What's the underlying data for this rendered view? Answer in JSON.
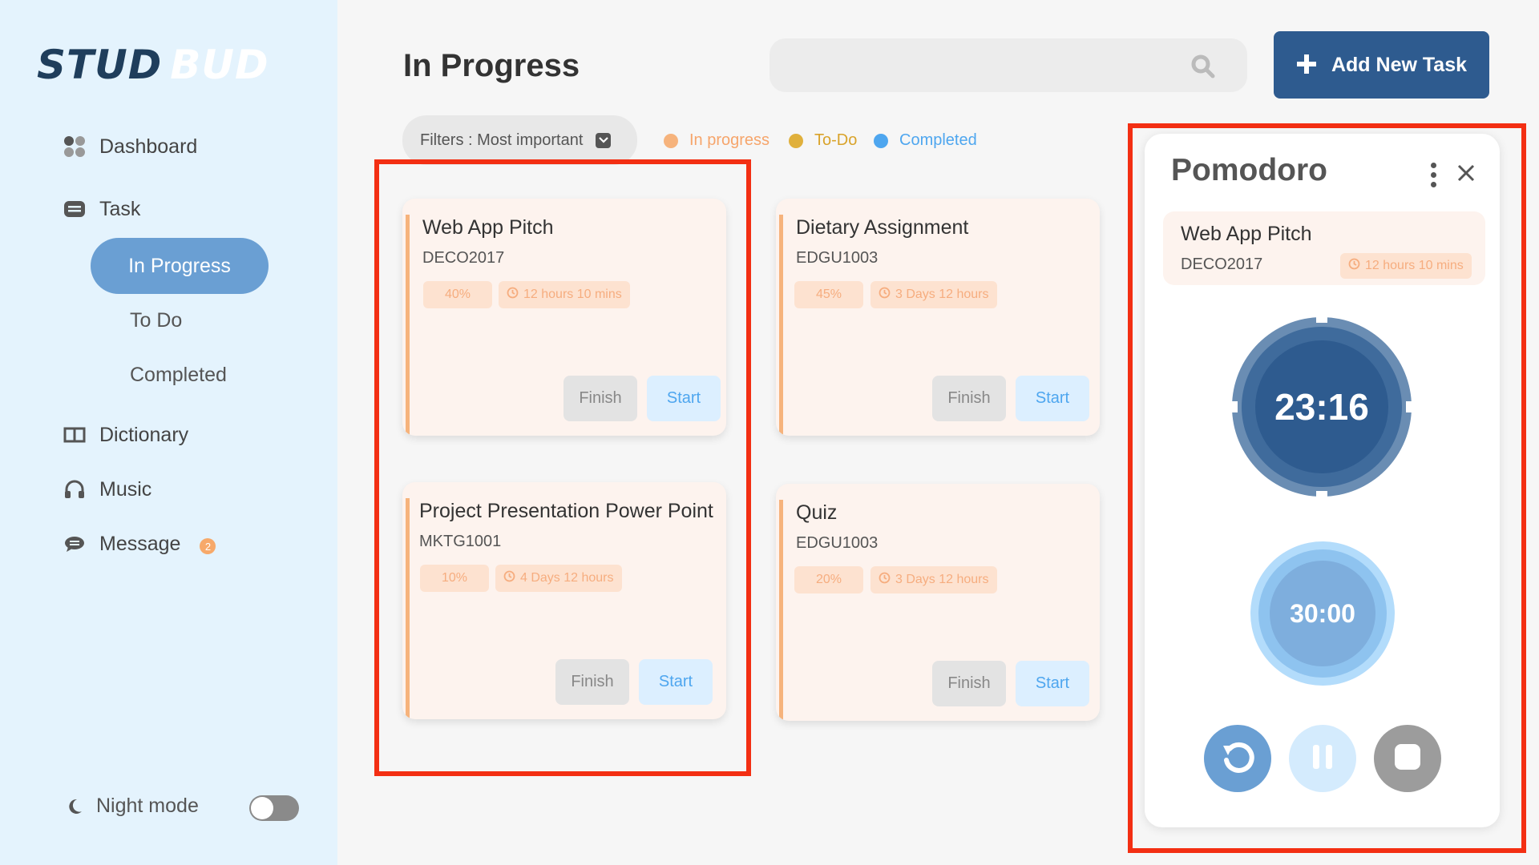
{
  "app": {
    "logo_part1": "STUD",
    "logo_part2": "BUD"
  },
  "sidebar": {
    "dashboard": "Dashboard",
    "task": "Task",
    "in_progress": "In Progress",
    "to_do": "To Do",
    "completed": "Completed",
    "dictionary": "Dictionary",
    "music": "Music",
    "message": "Message",
    "message_badge": "2",
    "night_mode": "Night mode"
  },
  "header": {
    "title": "In Progress",
    "search_placeholder": "",
    "add_button": "Add New Task"
  },
  "filters": {
    "label": "Filters : Most important"
  },
  "legend": [
    {
      "label": "In progress",
      "color": "#f6b37c"
    },
    {
      "label": "To-Do",
      "color": "#e0b03c"
    },
    {
      "label": "Completed",
      "color": "#4ea6ef"
    }
  ],
  "tasks": [
    {
      "title": "Web App Pitch",
      "code": "DECO2017",
      "progress": "40%",
      "time": "12 hours 10 mins",
      "finish": "Finish",
      "start": "Start"
    },
    {
      "title": "Dietary Assignment",
      "code": "EDGU1003",
      "progress": "45%",
      "time": "3 Days 12 hours",
      "finish": "Finish",
      "start": "Start"
    },
    {
      "title": "Project Presentation Power Point",
      "code": "MKTG1001",
      "progress": "10%",
      "time": "4 Days 12 hours",
      "finish": "Finish",
      "start": "Start"
    },
    {
      "title": "Quiz",
      "code": "EDGU1003",
      "progress": "20%",
      "time": "3 Days 12 hours",
      "finish": "Finish",
      "start": "Start"
    }
  ],
  "pomodoro": {
    "title": "Pomodoro",
    "task_title": "Web App Pitch",
    "task_code": "DECO2017",
    "task_time": "12 hours 10 mins",
    "timer_main": "23:16",
    "timer_secondary": "30:00"
  },
  "colors": {
    "primary": "#2e5b8f",
    "active_nav": "#6a9fd3",
    "highlight": "#f32f13",
    "card_bg": "#fdf3ee"
  }
}
